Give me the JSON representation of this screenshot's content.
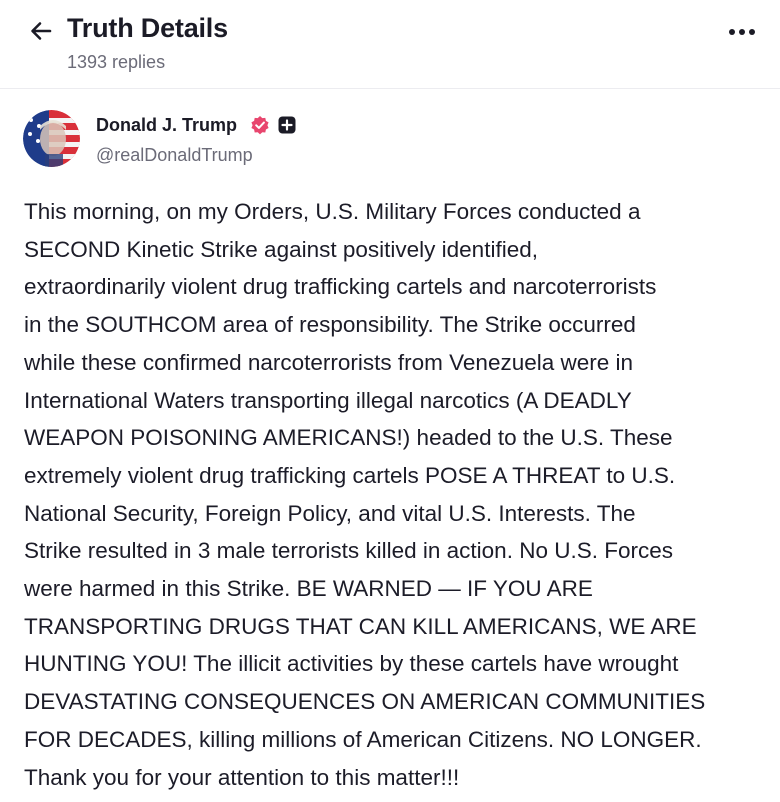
{
  "header": {
    "title": "Truth Details",
    "replies": "1393 replies",
    "back_icon": "arrow-left-icon",
    "more_icon": "more-horizontal-icon"
  },
  "author": {
    "name": "Donald J. Trump",
    "handle": "@realDonaldTrump",
    "verified_icon": "verified-badge-icon",
    "verified_color": "#e8466e",
    "plus_icon": "plus-badge-icon"
  },
  "post": {
    "lines": [
      "This morning, on my Orders, U.S. Military Forces conducted a",
      "SECOND Kinetic Strike against positively identified,",
      "extraordinarily violent drug trafficking cartels and narcoterrorists",
      "in the SOUTHCOM area of responsibility. The Strike occurred",
      "while these confirmed narcoterrorists from Venezuela were in",
      "International Waters transporting illegal narcotics (A DEADLY",
      "WEAPON POISONING AMERICANS!) headed to the U.S. These",
      "extremely violent drug trafficking cartels POSE A THREAT to U.S.",
      "National Security, Foreign Policy, and vital U.S. Interests. The",
      "Strike resulted in 3 male terrorists killed in action. No U.S. Forces",
      "were harmed in this Strike. BE WARNED — IF YOU ARE",
      "TRANSPORTING DRUGS THAT CAN KILL AMERICANS, WE ARE",
      "HUNTING YOU! The illicit activities by these cartels have wrought",
      "DEVASTATING CONSEQUENCES ON AMERICAN COMMUNITIES",
      "FOR DECADES, killing millions of American Citizens. NO LONGER.",
      "Thank you for your attention to this matter!!!"
    ]
  }
}
